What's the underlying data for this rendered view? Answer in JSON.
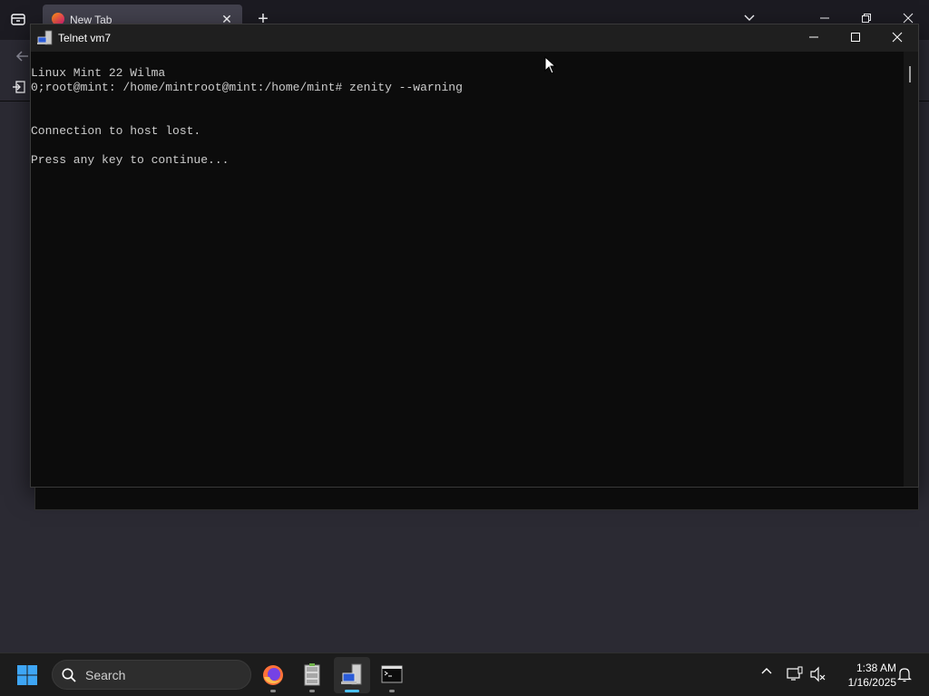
{
  "browser": {
    "tab_title": "New Tab",
    "new_tab_glyph": "+",
    "close_glyph": "✕",
    "icons": [
      "tab-list-icon",
      "firefox-favicon",
      "back-arrow-icon",
      "sidebar-icon"
    ]
  },
  "telnet": {
    "title": "Telnet vm7",
    "controls": {
      "minimize": "—",
      "maximize": "☐",
      "close": "✕"
    },
    "lines": [
      "Linux Mint 22 Wilma",
      "0;root@mint: /home/mintroot@mint:/home/mint# zenity --warning",
      "",
      "",
      "Connection to host lost.",
      "",
      "Press any key to continue..."
    ],
    "colors": {
      "background": "#0c0c0c",
      "text": "#cccccc",
      "titlebar": "#1f1f1f"
    }
  },
  "taskbar": {
    "search_label": "Search",
    "apps": [
      "firefox-icon",
      "file-cabinet-icon",
      "telnet-app-icon",
      "terminal-app-icon"
    ],
    "active_app": "telnet-app-icon",
    "clock_time": "1:38 AM",
    "clock_date": "1/16/2025",
    "accent": "#4cc2ff"
  }
}
